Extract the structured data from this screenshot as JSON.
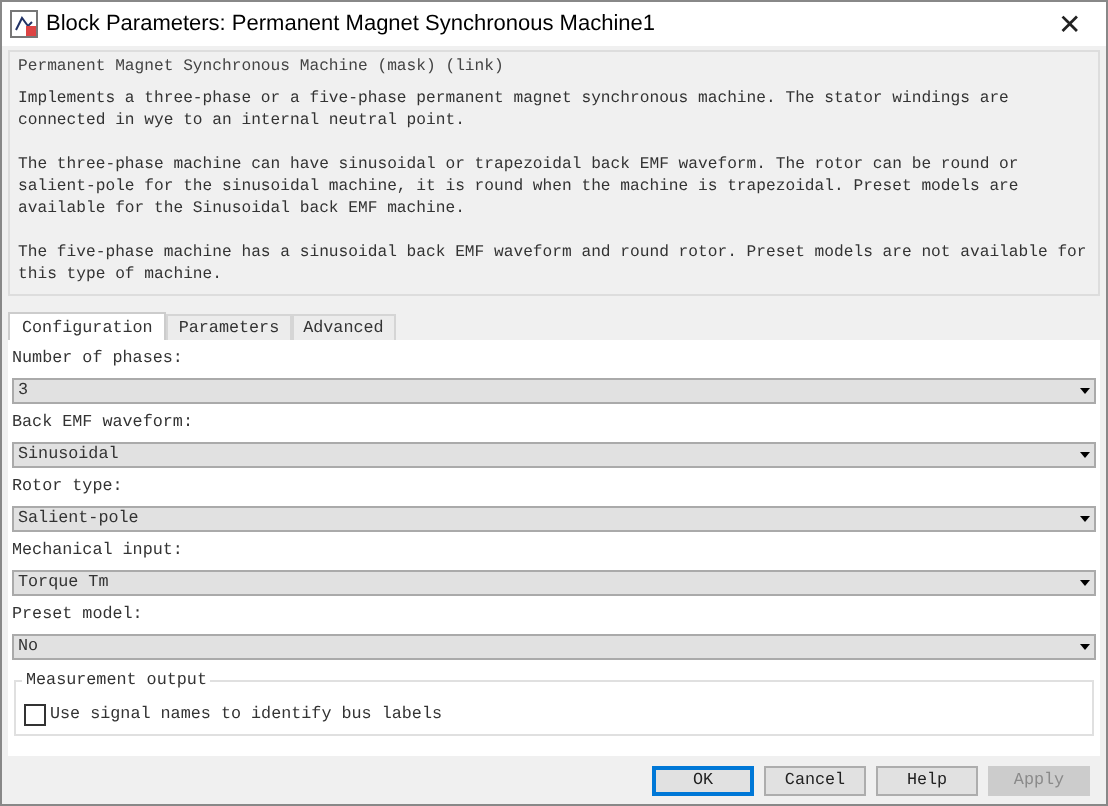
{
  "window": {
    "title": "Block Parameters: Permanent Magnet Synchronous Machine1",
    "close": "✕"
  },
  "mask": {
    "title": "Permanent Magnet Synchronous Machine (mask) (link)",
    "paragraphs": [
      "Implements a three-phase or a five-phase permanent magnet synchronous machine. The stator windings are connected in wye to an internal neutral point.",
      "The three-phase machine can have sinusoidal or trapezoidal back EMF waveform. The rotor can be round or salient-pole for the sinusoidal machine, it is round when the machine is trapezoidal. Preset models are available for the Sinusoidal back EMF machine.",
      "The five-phase machine has a sinusoidal back EMF waveform and round rotor. Preset models are not available for this type of machine."
    ]
  },
  "tabs": [
    {
      "label": "Configuration",
      "selected": true
    },
    {
      "label": "Parameters",
      "selected": false
    },
    {
      "label": "Advanced",
      "selected": false
    }
  ],
  "fields": [
    {
      "label": "Number of phases:",
      "value": "3"
    },
    {
      "label": "Back EMF waveform:",
      "value": "Sinusoidal"
    },
    {
      "label": "Rotor type:",
      "value": "Salient-pole"
    },
    {
      "label": "Mechanical input:",
      "value": "Torque Tm"
    },
    {
      "label": "Preset model:",
      "value": "No"
    }
  ],
  "measurement": {
    "title": "Measurement output",
    "checkbox": {
      "label": "Use signal names to identify bus labels",
      "checked": false
    }
  },
  "buttons": [
    {
      "label": "OK",
      "default": true,
      "disabled": false
    },
    {
      "label": "Cancel",
      "default": false,
      "disabled": false
    },
    {
      "label": "Help",
      "default": false,
      "disabled": false
    },
    {
      "label": "Apply",
      "default": false,
      "disabled": true
    }
  ]
}
